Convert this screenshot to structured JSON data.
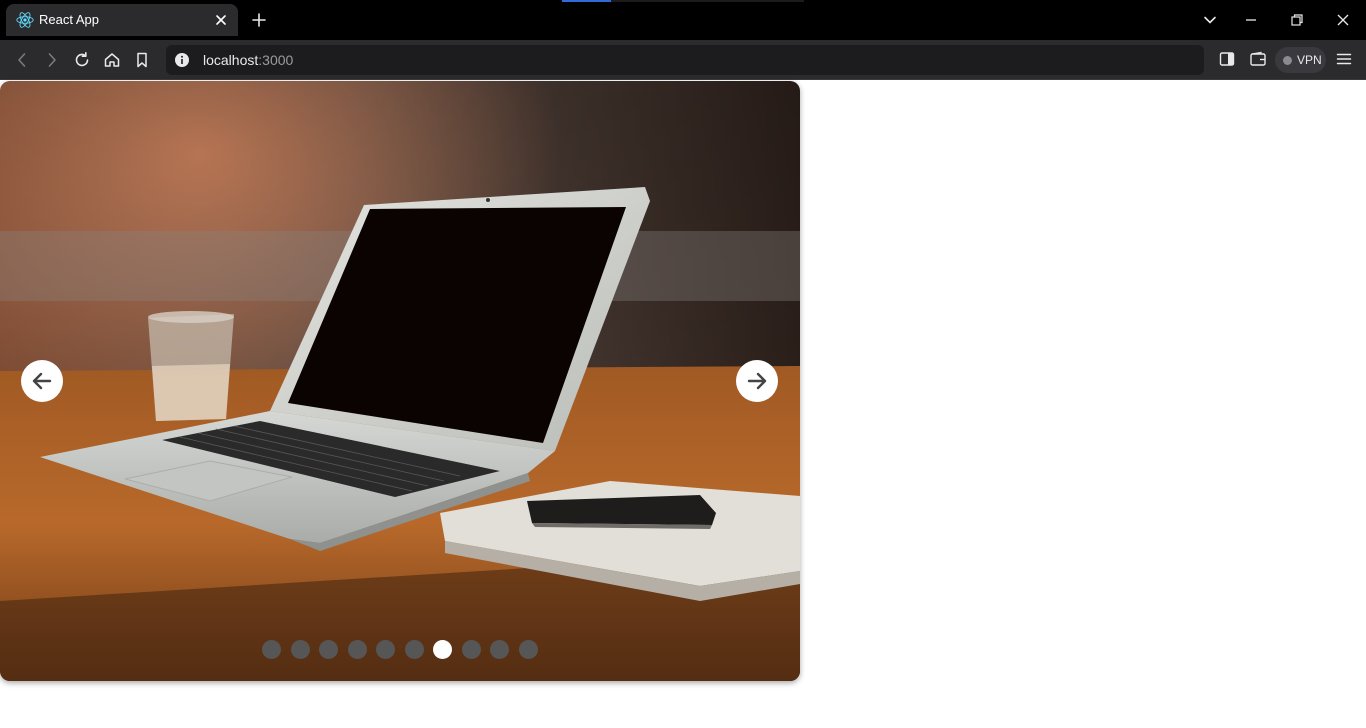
{
  "browser": {
    "tab_title": "React App",
    "url_host": "localhost",
    "url_port": ":3000",
    "vpn_label": "VPN",
    "colors": {
      "frame": "#000000",
      "toolbar": "#2b2b2e",
      "accent": "#2f6bd8",
      "brave": "#fb542b"
    }
  },
  "carousel": {
    "slide_count": 10,
    "active_index": 6,
    "icons": {
      "prev": "arrow-left-icon",
      "next": "arrow-right-icon"
    },
    "image_subject": "laptop on wooden table"
  }
}
